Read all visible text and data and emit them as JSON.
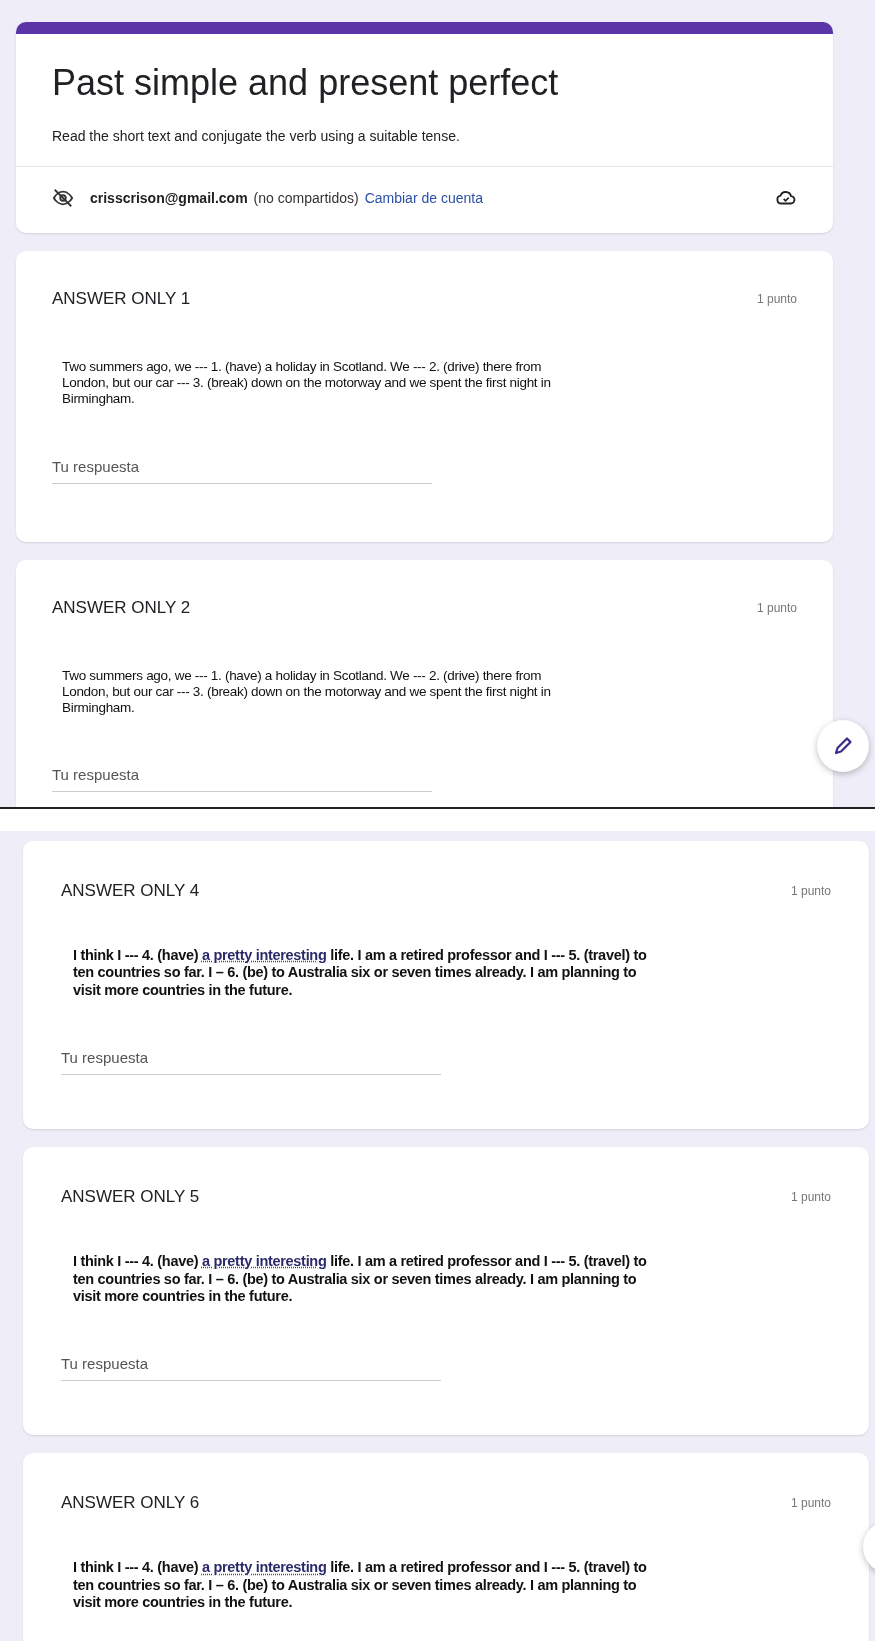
{
  "sections": [
    {
      "fab": true,
      "header": {
        "title": "Past simple and present perfect",
        "description": "Read the short text and conjugate the verb using a suitable tense.",
        "email": "crisscrison@gmail.com",
        "sharing": "(no compartidos)",
        "switch_link": "Cambiar de cuenta"
      },
      "questions": [
        {
          "title": "ANSWER ONLY 1",
          "points": "1 punto",
          "bold": false,
          "passage": {
            "before": "Two summers ago, we --- 1. (have) a holiday in Scotland. We --- 2. (drive) there from London, but our car --- 3. (break) down on the motorway and we spent the first night in Birmingham."
          },
          "placeholder": "Tu respuesta"
        },
        {
          "title": "ANSWER ONLY 2",
          "points": "1 punto",
          "bold": false,
          "passage": {
            "before": "Two summers ago, we --- 1. (have) a holiday in Scotland. We --- 2. (drive) there from London, but our car --- 3. (break) down on the motorway and we spent the first night in Birmingham."
          },
          "placeholder": "Tu respuesta"
        }
      ]
    },
    {
      "fab": true,
      "questions": [
        {
          "title": "ANSWER ONLY 4",
          "points": "1 punto",
          "bold": true,
          "passage": {
            "before": "I think I --- 4. (have) ",
            "flagged": "a pretty interesting",
            "after": " life. I am a retired professor and I --- 5. (travel) to ten countries so far. I – 6. (be) to Australia six or seven times already. I am planning to visit more countries in the future."
          },
          "placeholder": "Tu respuesta"
        },
        {
          "title": "ANSWER ONLY 5",
          "points": "1 punto",
          "bold": true,
          "passage": {
            "before": "I think I --- 4. (have) ",
            "flagged": "a pretty interesting",
            "after": " life. I am a retired professor and I --- 5. (travel) to ten countries so far. I – 6. (be) to Australia six or seven times already. I am planning to visit more countries in the future."
          },
          "placeholder": "Tu respuesta"
        },
        {
          "title": "ANSWER ONLY 6",
          "points": "1 punto",
          "bold": true,
          "passage": {
            "before": "I think I --- 4. (have) ",
            "flagged": "a pretty interesting",
            "after": " life. I am a retired professor and I --- 5. (travel) to ten countries so far. I – 6. (be) to Australia six or seven times already. I am planning to visit more countries in the future."
          }
        }
      ]
    }
  ]
}
